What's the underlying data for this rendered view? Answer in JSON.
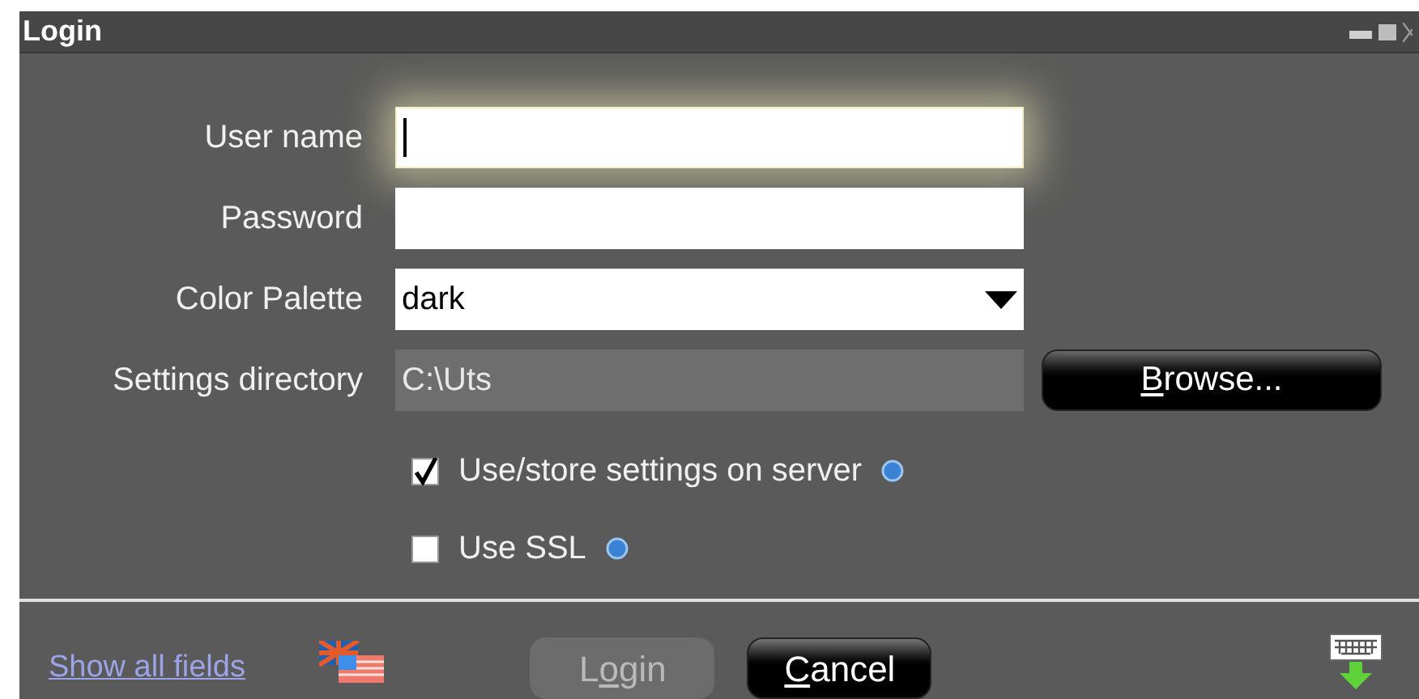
{
  "window": {
    "title": "Login"
  },
  "fields": [
    {
      "kind": "text",
      "label": "User name",
      "focused": true
    },
    {
      "kind": "text",
      "label": "Password",
      "focused": false
    },
    {
      "kind": "dropdown",
      "label": "Color Palette",
      "value": "dark"
    },
    {
      "kind": "readonly",
      "label": "Settings directory",
      "value": "C:\\Uts"
    }
  ],
  "browse_button": {
    "access_key": "B",
    "label_after": "rowse..."
  },
  "options": [
    {
      "label": "Use/store settings on server",
      "checked": true
    },
    {
      "label": "Use SSL",
      "checked": false
    }
  ],
  "footer": {
    "link": "Show all fields",
    "buttons": [
      {
        "label_before": "L",
        "access_key": "o",
        "label_after": "gin",
        "disabled": true
      },
      {
        "access_key": "C",
        "label_after": "ancel",
        "disabled": false
      }
    ]
  }
}
